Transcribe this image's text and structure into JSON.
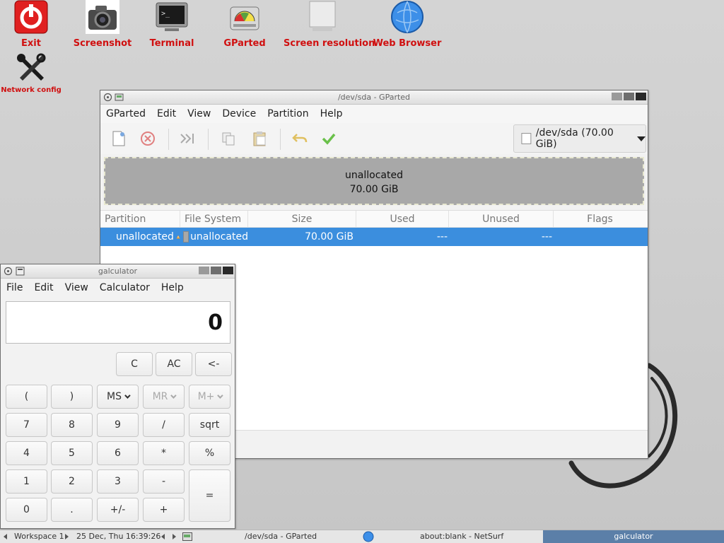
{
  "desktop": {
    "icons": [
      {
        "label": "Exit",
        "icon": "power-icon"
      },
      {
        "label": "Screenshot",
        "icon": "camera-icon"
      },
      {
        "label": "Terminal",
        "icon": "terminal-icon"
      },
      {
        "label": "GParted",
        "icon": "disk-icon"
      },
      {
        "label": "Screen resolution",
        "icon": "monitor-icon"
      },
      {
        "label": "Web Browser",
        "icon": "globe-icon"
      },
      {
        "label": "Network config",
        "icon": "wrench-icon"
      }
    ],
    "label_color": "#d01010"
  },
  "gparted": {
    "title": "/dev/sda - GParted",
    "menu": [
      "GParted",
      "Edit",
      "View",
      "Device",
      "Partition",
      "Help"
    ],
    "device_selector": "/dev/sda (70.00 GiB)",
    "disk_map": {
      "label": "unallocated",
      "size": "70.00 GiB"
    },
    "columns": [
      "Partition",
      "File System",
      "Size",
      "Used",
      "Unused",
      "Flags"
    ],
    "rows": [
      {
        "partition": "unallocated",
        "filesystem": "unallocated",
        "size": "70.00 GiB",
        "used": "---",
        "unused": "---",
        "flags": ""
      }
    ],
    "selection_color": "#3b8ede"
  },
  "calculator": {
    "title": "galculator",
    "menu": [
      "File",
      "Edit",
      "View",
      "Calculator",
      "Help"
    ],
    "display": "0",
    "top_buttons": [
      "C",
      "AC",
      "<-"
    ],
    "memory_buttons": [
      "(",
      ")",
      "MS",
      "MR",
      "M+"
    ],
    "rows": [
      [
        "7",
        "8",
        "9",
        "/",
        "sqrt"
      ],
      [
        "4",
        "5",
        "6",
        "*",
        "%"
      ],
      [
        "1",
        "2",
        "3",
        "-"
      ],
      [
        "0",
        ".",
        "+/-",
        "+"
      ]
    ],
    "equals": "="
  },
  "taskbar": {
    "workspace": "Workspace 1",
    "clock": "25 Dec, Thu 16:39:26",
    "tasks": [
      "/dev/sda - GParted",
      "about:blank - NetSurf",
      "galculator"
    ],
    "active_task": "galculator"
  }
}
